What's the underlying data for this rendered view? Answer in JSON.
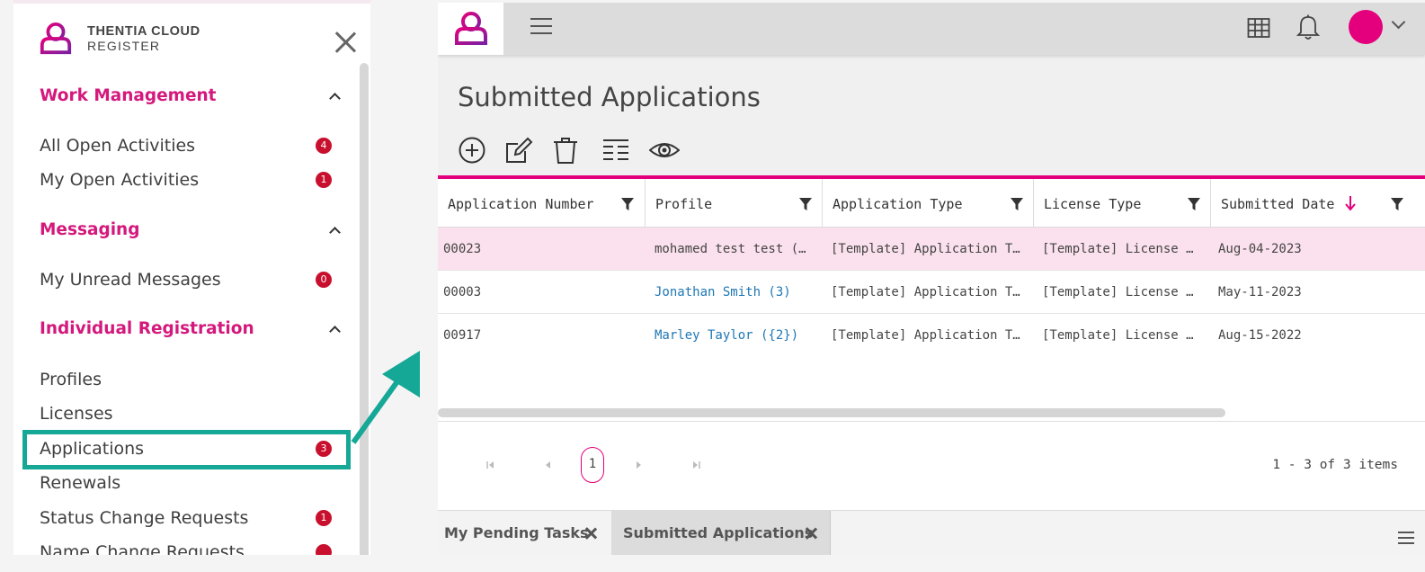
{
  "brand": {
    "line1": "THENTIA CLOUD",
    "line2": "REGISTER"
  },
  "sidebar": {
    "sections": [
      {
        "title": "Work Management",
        "items": [
          {
            "label": "All Open Activities",
            "badge": "4"
          },
          {
            "label": "My Open Activities",
            "badge": "1"
          }
        ]
      },
      {
        "title": "Messaging",
        "items": [
          {
            "label": "My Unread Messages",
            "badge": "0"
          }
        ]
      },
      {
        "title": "Individual Registration",
        "items": [
          {
            "label": "Profiles",
            "badge": ""
          },
          {
            "label": "Licenses",
            "badge": ""
          },
          {
            "label": "Applications",
            "badge": "3"
          },
          {
            "label": "Renewals",
            "badge": ""
          },
          {
            "label": "Status Change Requests",
            "badge": "1"
          },
          {
            "label": "Name Change Requests",
            "badge": ""
          }
        ]
      }
    ]
  },
  "main": {
    "title": "Submitted Applications",
    "toolbar": [
      "add-icon",
      "edit-icon",
      "delete-icon",
      "columns-icon",
      "view-icon"
    ],
    "columns": [
      "Application Number",
      "Profile",
      "Application Type",
      "License Type",
      "Submitted Date"
    ],
    "rows": [
      {
        "number": "00023",
        "profile": "mohamed test test (…",
        "app_type": "[Template] Application T…",
        "license_type": "[Template] License …",
        "date": "Aug-04-2023"
      },
      {
        "number": "00003",
        "profile": "Jonathan Smith (3)",
        "app_type": "[Template] Application T…",
        "license_type": "[Template] License …",
        "date": "May-11-2023"
      },
      {
        "number": "00917",
        "profile": "Marley Taylor ({2})",
        "app_type": "[Template] Application T…",
        "license_type": "[Template] License …",
        "date": "Aug-15-2022"
      }
    ],
    "pager": {
      "page": "1",
      "info": "1 - 3 of 3 items"
    },
    "tabs": [
      "My Pending Tasks",
      "Submitted Applications"
    ]
  },
  "colors": {
    "accent": "#e4007c",
    "heading": "#d4187c",
    "highlight": "#15a896",
    "badge": "#c8102e",
    "link": "#1f77b4"
  }
}
